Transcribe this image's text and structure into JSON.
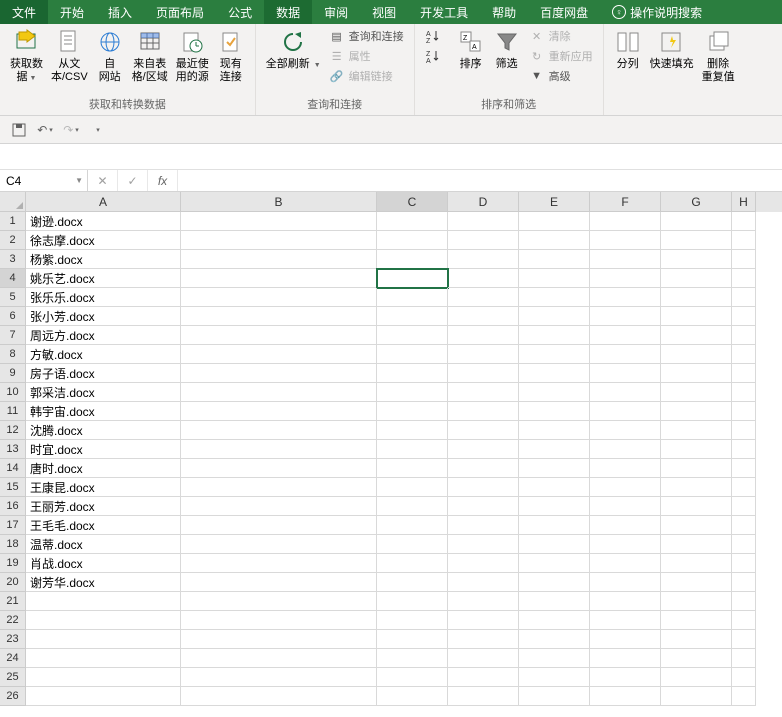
{
  "tabs": {
    "file": "文件",
    "items": [
      "开始",
      "插入",
      "页面布局",
      "公式",
      "数据",
      "审阅",
      "视图",
      "开发工具",
      "帮助",
      "百度网盘"
    ],
    "active": "数据",
    "helpSearch": "操作说明搜索"
  },
  "ribbon": {
    "group1": {
      "label": "获取和转换数据",
      "btn1_l1": "获取数",
      "btn1_l2": "据",
      "btn2_l1": "从文",
      "btn2_l2": "本/CSV",
      "btn3_l1": "自",
      "btn3_l2": "网站",
      "btn4_l1": "来自表",
      "btn4_l2": "格/区域",
      "btn5_l1": "最近使",
      "btn5_l2": "用的源",
      "btn6_l1": "现有",
      "btn6_l2": "连接"
    },
    "group2": {
      "label": "查询和连接",
      "btn1_l1": "全部刷新",
      "s1": "查询和连接",
      "s2": "属性",
      "s3": "编辑链接"
    },
    "group3": {
      "label": "排序和筛选",
      "btn2": "排序",
      "btn3": "筛选",
      "s1": "清除",
      "s2": "重新应用",
      "s3": "高级"
    },
    "group4": {
      "btn1": "分列",
      "btn2": "快速填充",
      "btn3_l1": "删除",
      "btn3_l2": "重复值"
    }
  },
  "nameBox": "C4",
  "columns": [
    "A",
    "B",
    "C",
    "D",
    "E",
    "F",
    "G",
    "H"
  ],
  "rows": [
    "谢逊.docx",
    "徐志摩.docx",
    "杨紫.docx",
    "姚乐艺.docx",
    "张乐乐.docx",
    "张小芳.docx",
    "周远方.docx",
    "方敏.docx",
    "房子语.docx",
    "郭采洁.docx",
    "韩宇宙.docx",
    "沈腾.docx",
    "时宜.docx",
    "唐时.docx",
    "王康昆.docx",
    "王丽芳.docx",
    "王毛毛.docx",
    "温蒂.docx",
    "肖战.docx",
    "谢芳华.docx",
    "",
    "",
    "",
    "",
    "",
    ""
  ],
  "selectedCell": {
    "row": 4,
    "col": "C"
  }
}
